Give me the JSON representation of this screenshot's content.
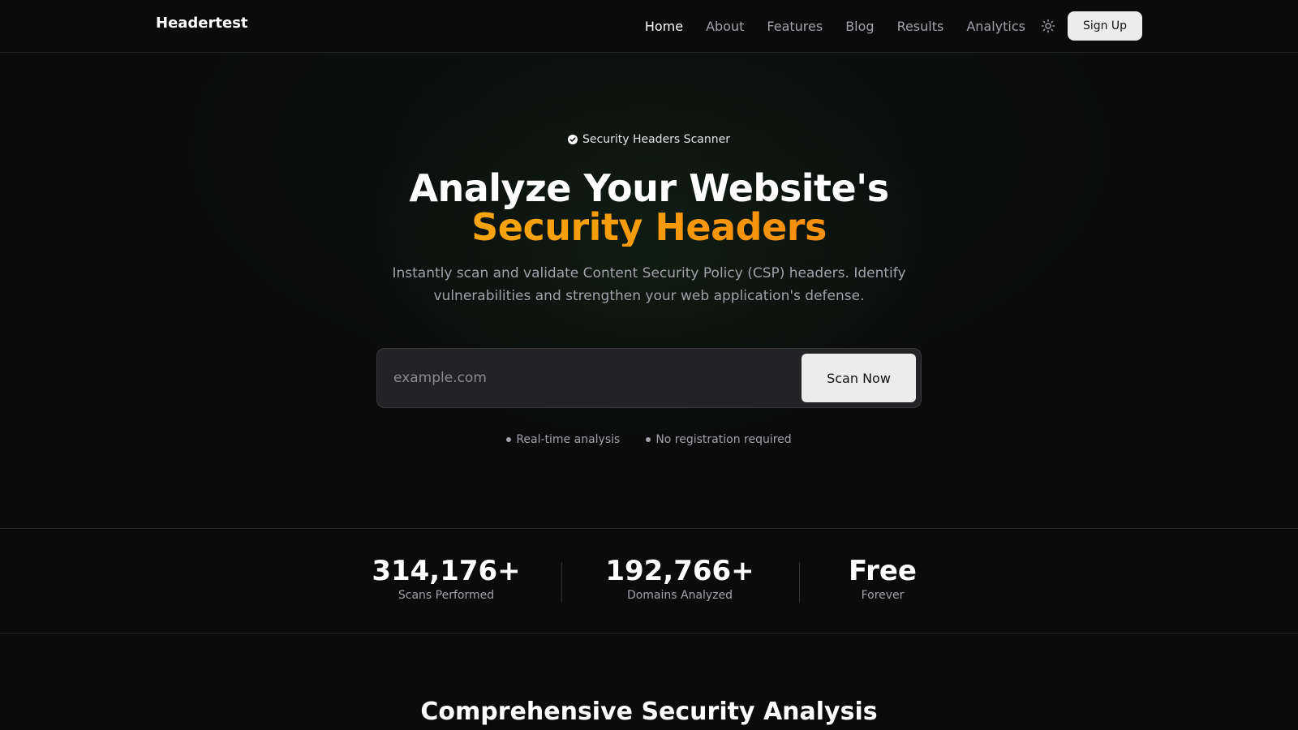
{
  "nav": {
    "brand": "Headertest",
    "links": [
      {
        "label": "Home"
      },
      {
        "label": "About"
      },
      {
        "label": "Features"
      },
      {
        "label": "Blog"
      },
      {
        "label": "Results"
      },
      {
        "label": "Analytics"
      }
    ],
    "theme_icon": "sun-icon",
    "signup_label": "Sign Up"
  },
  "hero": {
    "badge_icon": "check-circle-icon",
    "badge": "Security Headers Scanner",
    "title_line1": "Analyze Your Website's",
    "title_line2": "Security Headers",
    "subtitle": "Instantly scan and validate Content Security Policy (CSP) headers. Identify vulnerabilities and strengthen your web application's defense.",
    "input_placeholder": "example.com",
    "input_value": "",
    "scan_button": "Scan Now",
    "features": [
      {
        "label": "Real-time analysis"
      },
      {
        "label": "No registration required"
      }
    ]
  },
  "stats": [
    {
      "value": "314,176+",
      "label": "Scans Performed"
    },
    {
      "value": "192,766+",
      "label": "Domains Analyzed"
    },
    {
      "value": "Free",
      "label": "Forever"
    }
  ],
  "section": {
    "title": "Comprehensive Security Analysis"
  },
  "colors": {
    "background": "#0b0b0c",
    "accent_start": "#fbbf24",
    "accent_end": "#f97316",
    "muted_text": "#a1a1aa",
    "button_bg": "#ececec"
  }
}
